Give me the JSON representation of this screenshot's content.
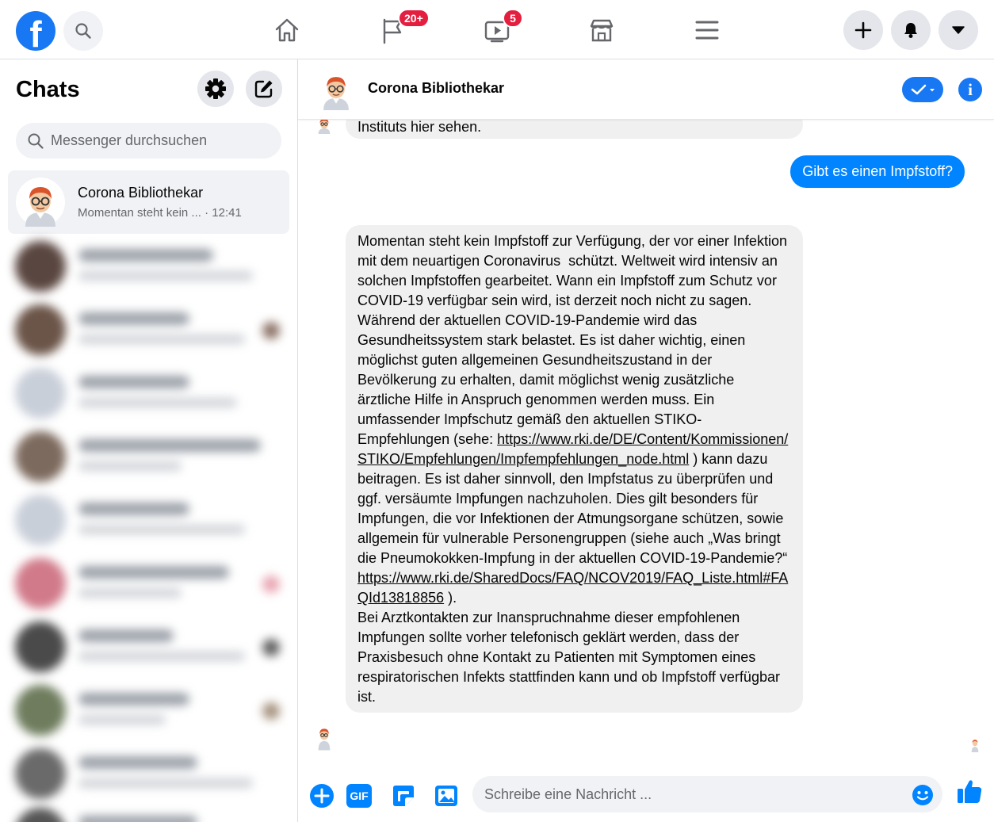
{
  "topbar": {
    "logo_letter": "f",
    "notifications_badge": "20+",
    "watch_badge": "5",
    "icons": [
      "facebook-logo",
      "search-icon",
      "home-icon",
      "flag-icon",
      "watch-icon",
      "marketplace-icon",
      "menu-icon",
      "plus-icon",
      "bell-icon",
      "caret-down-icon"
    ]
  },
  "sidebar": {
    "title": "Chats",
    "search_placeholder": "Messenger durchsuchen",
    "active_chat": {
      "name": "Corona Bibliothekar",
      "preview": "Momentan steht kein ...",
      "time": "· 12:41"
    }
  },
  "conversation": {
    "contact_name": "Corona Bibliothekar",
    "previous_message_tail": "Instituts hier sehen.",
    "user_message": "Gibt es einen Impfstoff?",
    "reply_part1": "Momentan steht kein Impfstoff zur Verfügung, der vor einer Infektion mit dem neuartigen Coronavirus  schützt. Weltweit wird intensiv an solchen Impfstoffen gearbeitet. Wann ein Impfstoff zum Schutz vor COVID-19 verfügbar sein wird, ist derzeit noch nicht zu sagen.\nWährend der aktuellen COVID-19-Pandemie wird das Gesundheitssystem stark belastet. Es ist daher wichtig, einen möglichst guten allgemeinen Gesundheitszustand in der Bevölkerung zu erhalten, damit möglichst wenig zusätzliche ärztliche Hilfe in Anspruch genommen werden muss. Ein umfassender Impfschutz gemäß den aktuellen STIKO-Empfehlungen (sehe: ",
    "reply_link1": "https://www.rki.de/DE/Content/Kommissionen/STIKO/Empfehlungen/Impfempfehlungen_node.html",
    "reply_part2": " ) kann dazu beitragen. Es ist daher sinnvoll, den Impfstatus zu überprüfen und ggf. versäumte Impfungen nachzuholen. Dies gilt besonders für Impfungen, die vor Infektionen der Atmungsorgane schützen, sowie allgemein für vulnerable Personengruppen (siehe auch „Was bringt die Pneumokokken-Impfung in der aktuellen COVID-19-Pandemie?“ ",
    "reply_link2": "https://www.rki.de/SharedDocs/FAQ/NCOV2019/FAQ_Liste.html#FAQId13818856",
    "reply_part3": " ).\nBei Arztkontakten zur Inanspruchnahme dieser empfohlenen Impfungen sollte vorher telefonisch geklärt werden, dass der Praxisbesuch ohne Kontakt zu Patienten mit Symptomen eines respiratorischen Infekts stattfinden kann und ob Impfstoff verfügbar ist."
  },
  "composer": {
    "placeholder": "Schreibe eine Nachricht ...",
    "gif_label": "GIF"
  },
  "colors": {
    "brand_blue": "#1877f2",
    "messenger_blue": "#0084ff",
    "badge_red": "#e41e3f",
    "bubble_gray": "#f0f0f0"
  }
}
